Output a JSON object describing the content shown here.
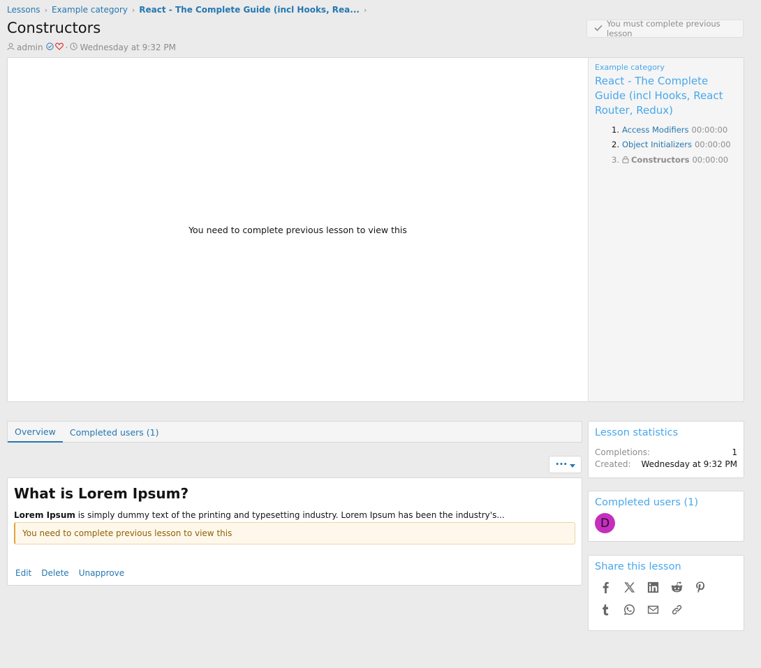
{
  "breadcrumb": [
    {
      "label": "Lessons",
      "bold": false
    },
    {
      "label": "Example category",
      "bold": false
    },
    {
      "label": "React - The Complete Guide (incl Hooks, Rea...",
      "bold": true
    }
  ],
  "page_title": "Constructors",
  "complete_button": "You must complete previous lesson",
  "meta": {
    "author": "admin",
    "date": "Wednesday at 9:32 PM",
    "sep": "·"
  },
  "video_notice": "You need to complete previous lesson to view this",
  "side": {
    "category": "Example category",
    "course": "React - The Complete Guide (incl Hooks, React Router, Redux)",
    "lessons": [
      {
        "num": "1.",
        "title": "Access Modifiers",
        "duration": "00:00:00"
      },
      {
        "num": "2.",
        "title": "Object Initializers",
        "duration": "00:00:00"
      },
      {
        "num": "3.",
        "title": "Constructors",
        "duration": "00:00:00"
      }
    ]
  },
  "tabs": {
    "overview": "Overview",
    "completed": "Completed users (1)"
  },
  "more_button": "•••",
  "article": {
    "heading": "What is Lorem Ipsum?",
    "excerpt_bold": "Lorem Ipsum",
    "excerpt_rest": " is simply dummy text of the printing and typesetting industry. Lorem Ipsum has been the industry's...",
    "notice": "You need to complete previous lesson to view this",
    "actions": {
      "edit": "Edit",
      "delete": "Delete",
      "unapprove": "Unapprove"
    }
  },
  "stats": {
    "title": "Lesson statistics",
    "completions_label": "Completions:",
    "completions_value": "1",
    "created_label": "Created:",
    "created_value": "Wednesday at 9:32 PM"
  },
  "completed_users": {
    "title": "Completed users (1)",
    "avatar_letter": "D",
    "avatar_color": "#c42fbe"
  },
  "share": {
    "title": "Share this lesson",
    "icons": [
      "facebook-icon",
      "x-icon",
      "linkedin-icon",
      "reddit-icon",
      "pinterest-icon",
      "tumblr-icon",
      "whatsapp-icon",
      "email-icon",
      "link-icon"
    ]
  },
  "colors": {
    "link": "#2577b1",
    "light_link": "#47a7eb",
    "muted": "#8c8c8c",
    "notice_bg": "#fef8ec",
    "notice_text": "#916002"
  }
}
